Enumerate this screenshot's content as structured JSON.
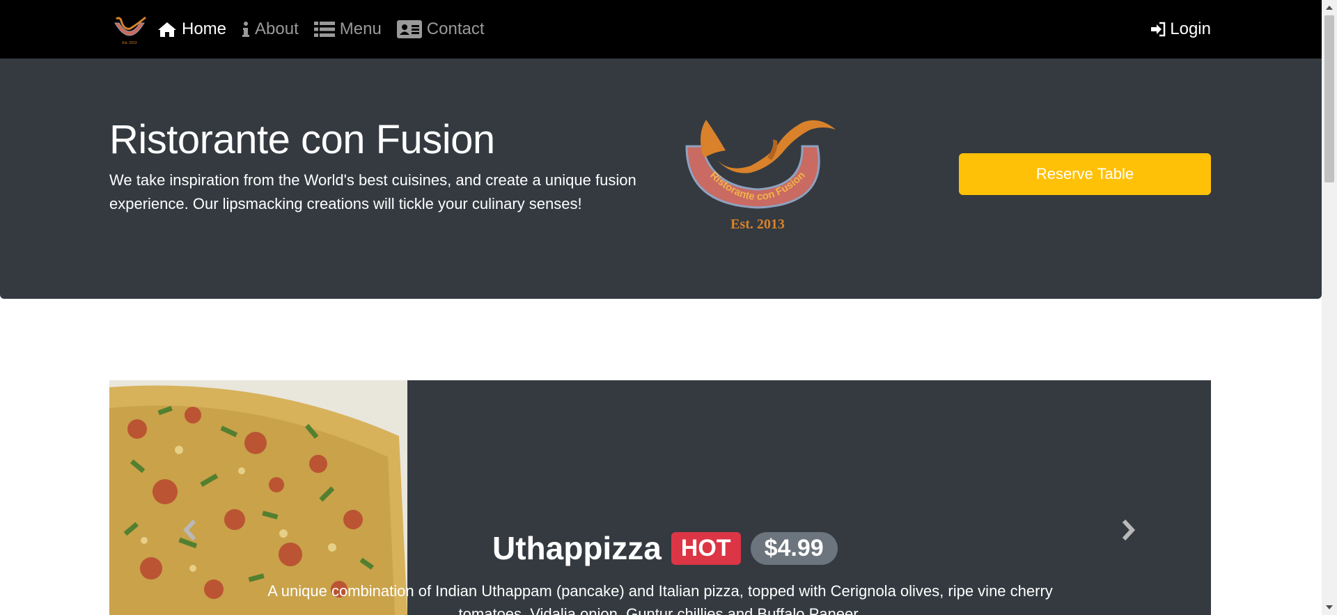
{
  "navbar": {
    "links": [
      {
        "label": "Home",
        "icon": "home-icon",
        "active": true
      },
      {
        "label": "About",
        "icon": "info-icon",
        "active": false
      },
      {
        "label": "Menu",
        "icon": "list-icon",
        "active": false
      },
      {
        "label": "Contact",
        "icon": "address-card-icon",
        "active": false
      }
    ],
    "login_label": "Login",
    "logo_text": "Est. 2013"
  },
  "jumbotron": {
    "title": "Ristorante con Fusion",
    "description": "We take inspiration from the World's best cuisines, and create a unique fusion experience. Our lipsmacking creations will tickle your culinary senses!",
    "logo_name": "Ristorante con Fusion",
    "logo_established": "Est. 2013",
    "reserve_label": "Reserve Table"
  },
  "carousel": {
    "dish_name": "Uthappizza",
    "badge": "HOT",
    "price": "$4.99",
    "description": "A unique combination of Indian Uthappam (pancake) and Italian pizza, topped with Cerignola olives, ripe vine cherry tomatoes, Vidalia onion, Guntur chillies and Buffalo Paneer."
  },
  "colors": {
    "navbar_bg": "#000000",
    "jumbotron_bg": "#343a40",
    "reserve_button": "#ffc107",
    "hot_badge": "#dc3545",
    "price_badge": "#6c757d"
  }
}
